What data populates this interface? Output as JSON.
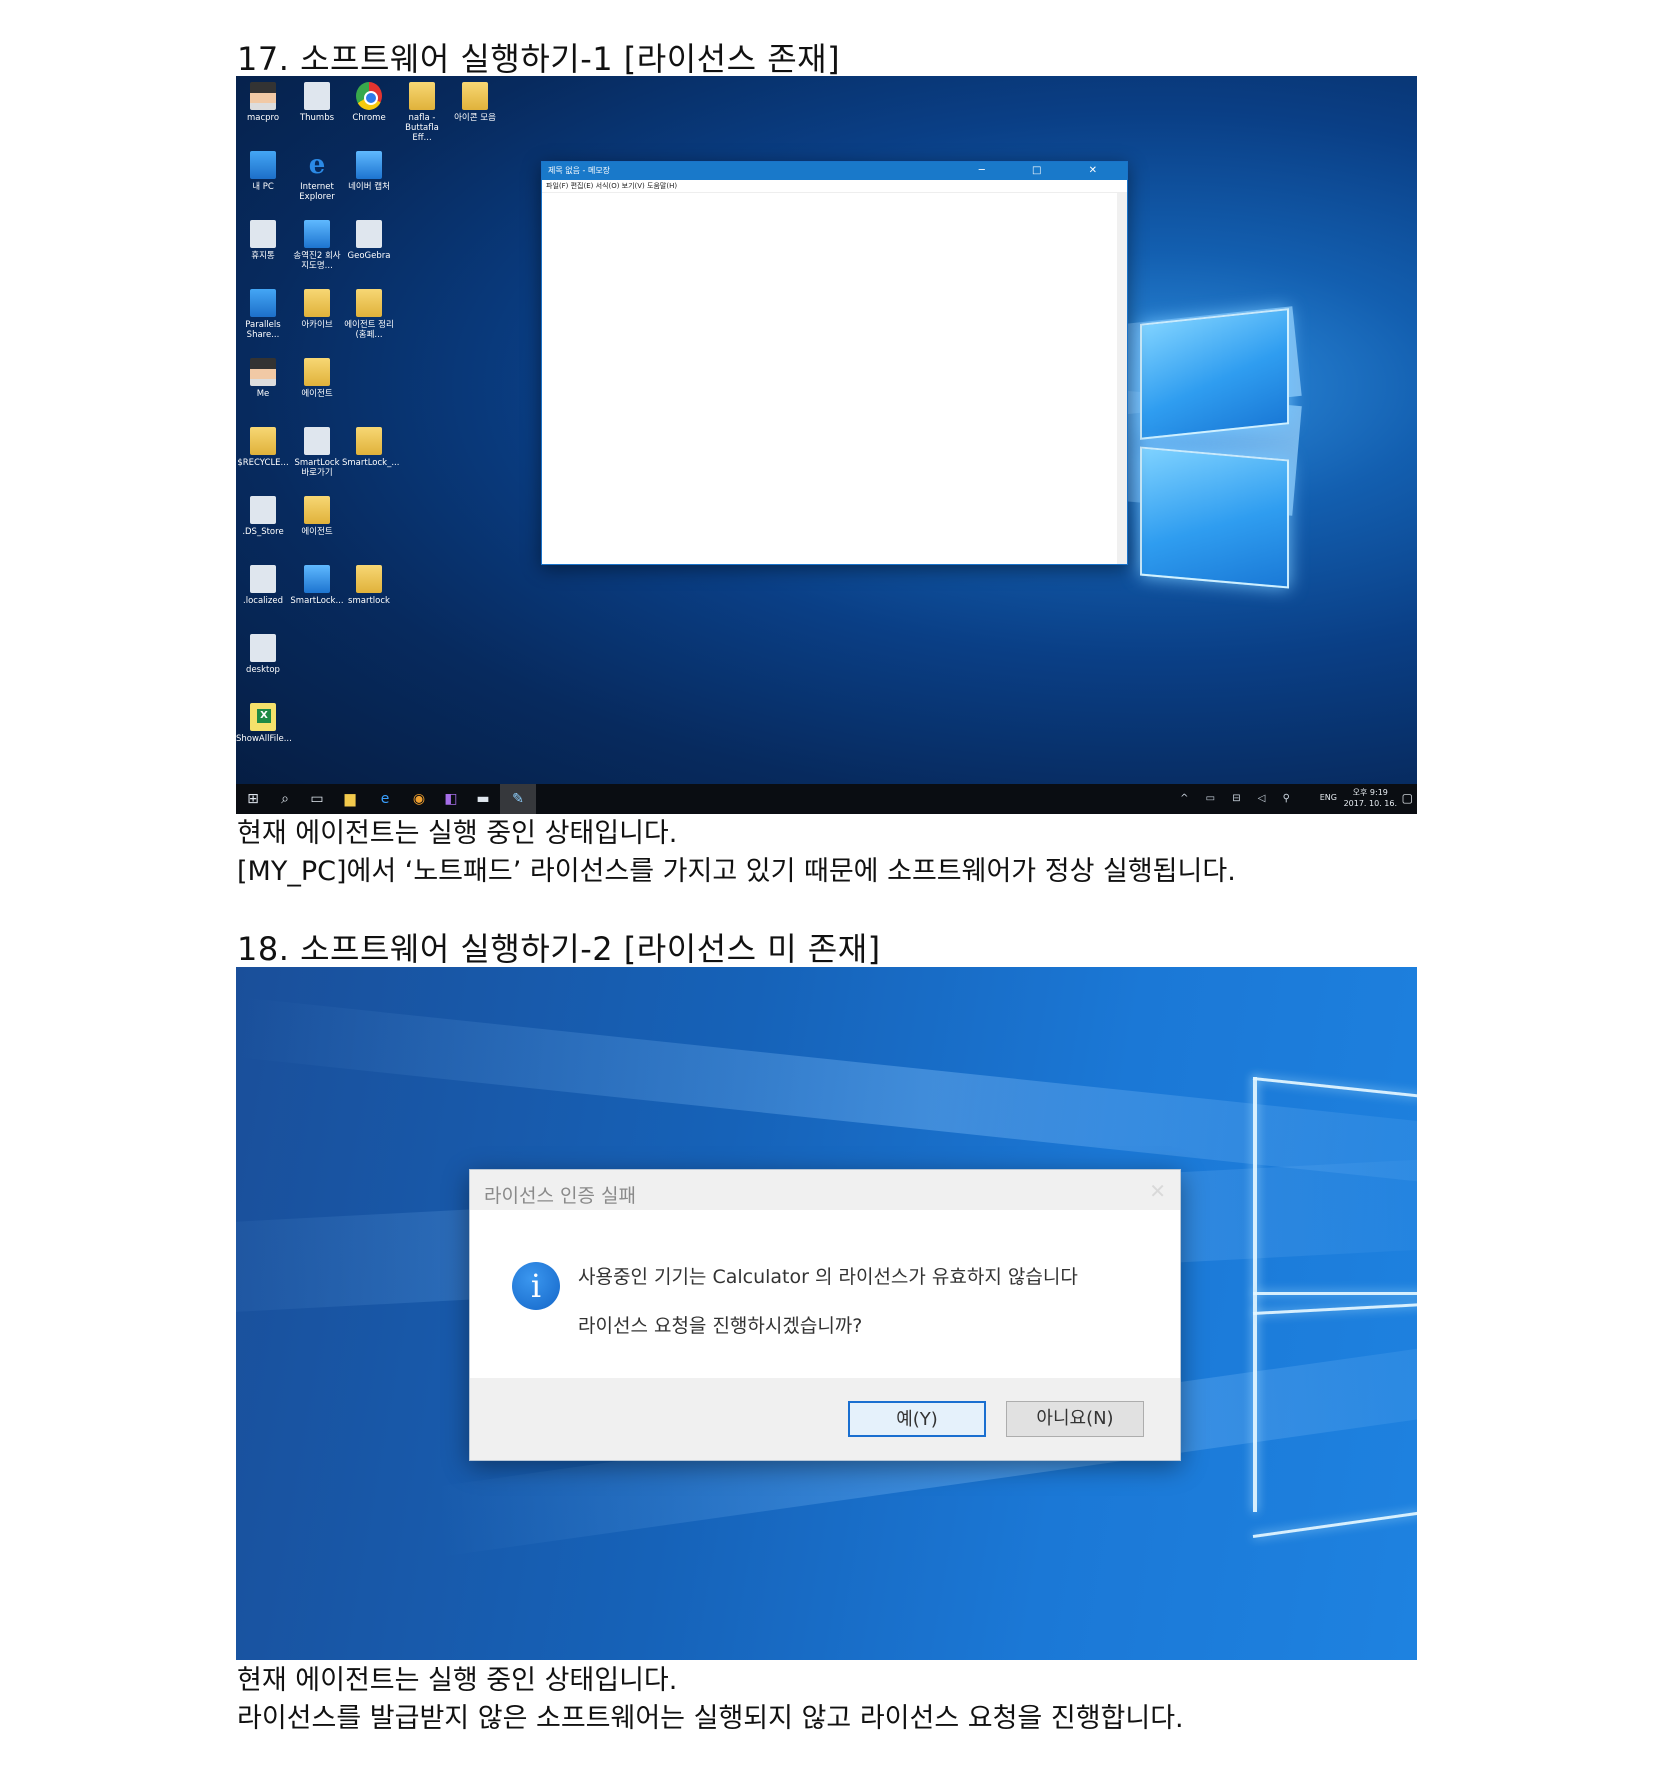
{
  "section1": {
    "heading": "17. 소프트웨어 실행하기-1 [라이선스 존재]",
    "caption_line1": "현재 에이전트는 실행 중인 상태입니다.",
    "caption_line2": "[MY_PC]에서 ‘노트패드’ 라이선스를 가지고 있기 때문에 소프트웨어가 정상 실행됩니다."
  },
  "section2": {
    "heading": "18. 소프트웨어 실행하기-2 [라이선스 미 존재]",
    "caption_line1": "현재 에이전트는 실행 중인 상태입니다.",
    "caption_line2": "라이선스를 발급받지 않은 소프트웨어는 실행되지 않고 라이선스 요청을 진행합니다."
  },
  "desktop_icons": [
    {
      "label": "macpro",
      "icon": "person-folder-icon"
    },
    {
      "label": "Thumbs",
      "icon": "file-icon"
    },
    {
      "label": "Chrome",
      "icon": "chrome-icon"
    },
    {
      "label": "nafla - Buttafla Eff...",
      "icon": "folder-icon"
    },
    {
      "label": "아이콘 모음",
      "icon": "folder-icon"
    },
    {
      "label": "내 PC",
      "icon": "computer-icon"
    },
    {
      "label": "Internet Explorer",
      "icon": "ie-icon"
    },
    {
      "label": "네이버 캡처",
      "icon": "capture-icon"
    },
    {
      "label": "휴지통",
      "icon": "recycle-bin-icon"
    },
    {
      "label": "송역진2 회사지도명...",
      "icon": "file-icon"
    },
    {
      "label": "GeoGebra",
      "icon": "geogebra-icon"
    },
    {
      "label": "Parallels Share...",
      "icon": "computer-icon"
    },
    {
      "label": "아카이브",
      "icon": "folder-icon"
    },
    {
      "label": "에이전트 정리(홈페...",
      "icon": "folder-icon"
    },
    {
      "label": "Me",
      "icon": "person-icon"
    },
    {
      "label": "에이전트",
      "icon": "folder-icon"
    },
    {
      "label": "$RECYCLE...",
      "icon": "folder-icon"
    },
    {
      "label": "SmartLock 바로가기",
      "icon": "shortcut-icon"
    },
    {
      "label": "SmartLock_...",
      "icon": "folder-icon"
    },
    {
      "label": ".DS_Store",
      "icon": "file-icon"
    },
    {
      "label": "에이전트",
      "icon": "folder-icon"
    },
    {
      "label": ".localized",
      "icon": "file-icon"
    },
    {
      "label": "SmartLock...",
      "icon": "app-icon"
    },
    {
      "label": "smartlock",
      "icon": "folder-icon"
    },
    {
      "label": "desktop",
      "icon": "file-icon"
    },
    {
      "label": "ShowAllFile...",
      "icon": "excel-icon"
    }
  ],
  "notepad": {
    "title": "제목 없음 - 메모장",
    "menu": "파일(F)  편집(E)  서식(O)  보기(V)  도움말(H)",
    "controls": "─ □ ✕"
  },
  "taskbar": {
    "tray_icons": "^ ▭ ⊟ ◁ ⚲",
    "lang": "ENG",
    "time": "오후 9:19",
    "date": "2017. 10. 16."
  },
  "dialog": {
    "title": "라이선스 인증 실패",
    "close": "✕",
    "info_glyph": "i",
    "message1": "사용중인 기기는 Calculator 의 라이선스가 유효하지 않습니다",
    "message2": "라이선스 요청을 진행하시겠습니까?",
    "yes_label": "예(Y)",
    "no_label": "아니요(N)"
  }
}
